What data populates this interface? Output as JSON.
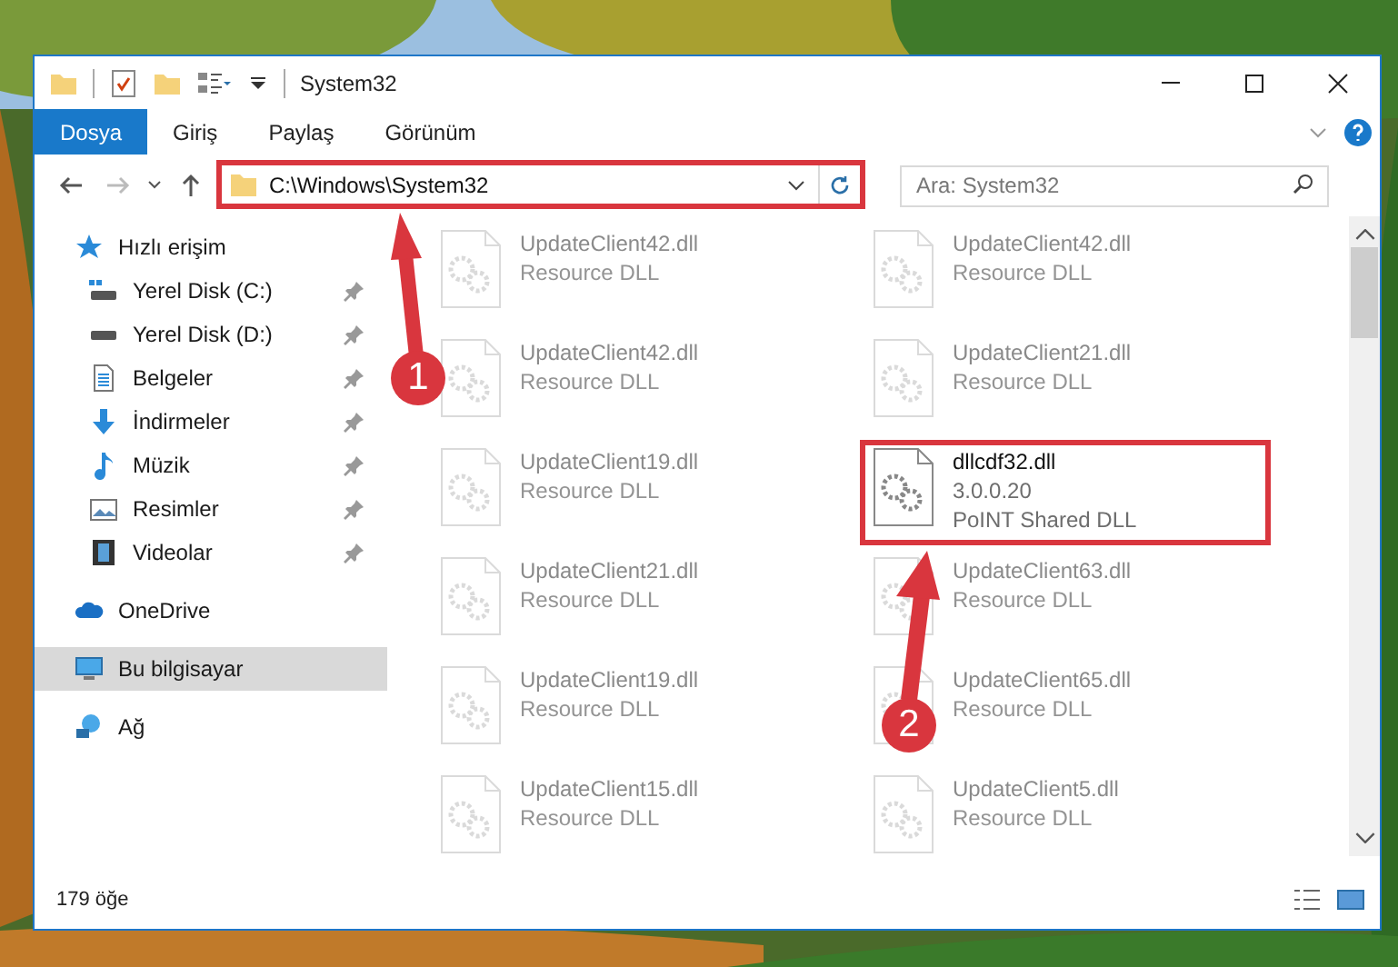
{
  "window": {
    "title": "System32"
  },
  "ribbon_tabs": [
    {
      "label": "Dosya",
      "selected": true
    },
    {
      "label": "Giriş",
      "selected": false
    },
    {
      "label": "Paylaş",
      "selected": false
    },
    {
      "label": "Görünüm",
      "selected": false
    }
  ],
  "address": {
    "value": "C:\\Windows\\System32",
    "highlighted": true
  },
  "search": {
    "placeholder": "Ara: System32"
  },
  "sidebar": {
    "items": [
      {
        "label": "Hızlı erişim",
        "kind": "star",
        "selected": false,
        "children": [
          {
            "label": "Yerel Disk (C:)",
            "kind": "drive_c",
            "selected": false,
            "pinned": true
          },
          {
            "label": "Yerel Disk (D:)",
            "kind": "drive",
            "selected": false,
            "pinned": true
          },
          {
            "label": "Belgeler",
            "kind": "document",
            "selected": false,
            "pinned": true
          },
          {
            "label": "İndirmeler",
            "kind": "download",
            "selected": false,
            "pinned": true
          },
          {
            "label": "Müzik",
            "kind": "music",
            "selected": false,
            "pinned": true
          },
          {
            "label": "Resimler",
            "kind": "pictures",
            "selected": false,
            "pinned": true
          },
          {
            "label": "Videolar",
            "kind": "video",
            "selected": false,
            "pinned": true
          }
        ]
      },
      {
        "label": "OneDrive",
        "kind": "cloud",
        "selected": false
      },
      {
        "label": "Bu bilgisayar",
        "kind": "computer",
        "selected": true
      },
      {
        "label": "Ağ",
        "kind": "network",
        "selected": false
      }
    ]
  },
  "files": [
    {
      "name": "UpdateClient42.dll",
      "lines": [
        "Resource DLL"
      ],
      "faded": true,
      "highlighted": false
    },
    {
      "name": "UpdateClient42.dll",
      "lines": [
        "Resource DLL"
      ],
      "faded": true,
      "highlighted": false
    },
    {
      "name": "UpdateClient42.dll",
      "lines": [
        "Resource DLL"
      ],
      "faded": true,
      "highlighted": false
    },
    {
      "name": "UpdateClient21.dll",
      "lines": [
        "Resource DLL"
      ],
      "faded": true,
      "highlighted": false
    },
    {
      "name": "UpdateClient19.dll",
      "lines": [
        "Resource DLL"
      ],
      "faded": true,
      "highlighted": false
    },
    {
      "name": "dllcdf32.dll",
      "lines": [
        "3.0.0.20",
        "PoINT Shared DLL"
      ],
      "faded": false,
      "highlighted": true
    },
    {
      "name": "UpdateClient21.dll",
      "lines": [
        "Resource DLL"
      ],
      "faded": true,
      "highlighted": false
    },
    {
      "name": "UpdateClient63.dll",
      "lines": [
        "Resource DLL"
      ],
      "faded": true,
      "highlighted": false
    },
    {
      "name": "UpdateClient19.dll",
      "lines": [
        "Resource DLL"
      ],
      "faded": true,
      "highlighted": false
    },
    {
      "name": "UpdateClient65.dll",
      "lines": [
        "Resource DLL"
      ],
      "faded": true,
      "highlighted": false
    },
    {
      "name": "UpdateClient15.dll",
      "lines": [
        "Resource DLL"
      ],
      "faded": true,
      "highlighted": false
    },
    {
      "name": "UpdateClient5.dll",
      "lines": [
        "Resource DLL"
      ],
      "faded": true,
      "highlighted": false
    }
  ],
  "annotations": [
    {
      "number": "1"
    },
    {
      "number": "2"
    }
  ],
  "status_bar": {
    "count": "179 öğe"
  }
}
